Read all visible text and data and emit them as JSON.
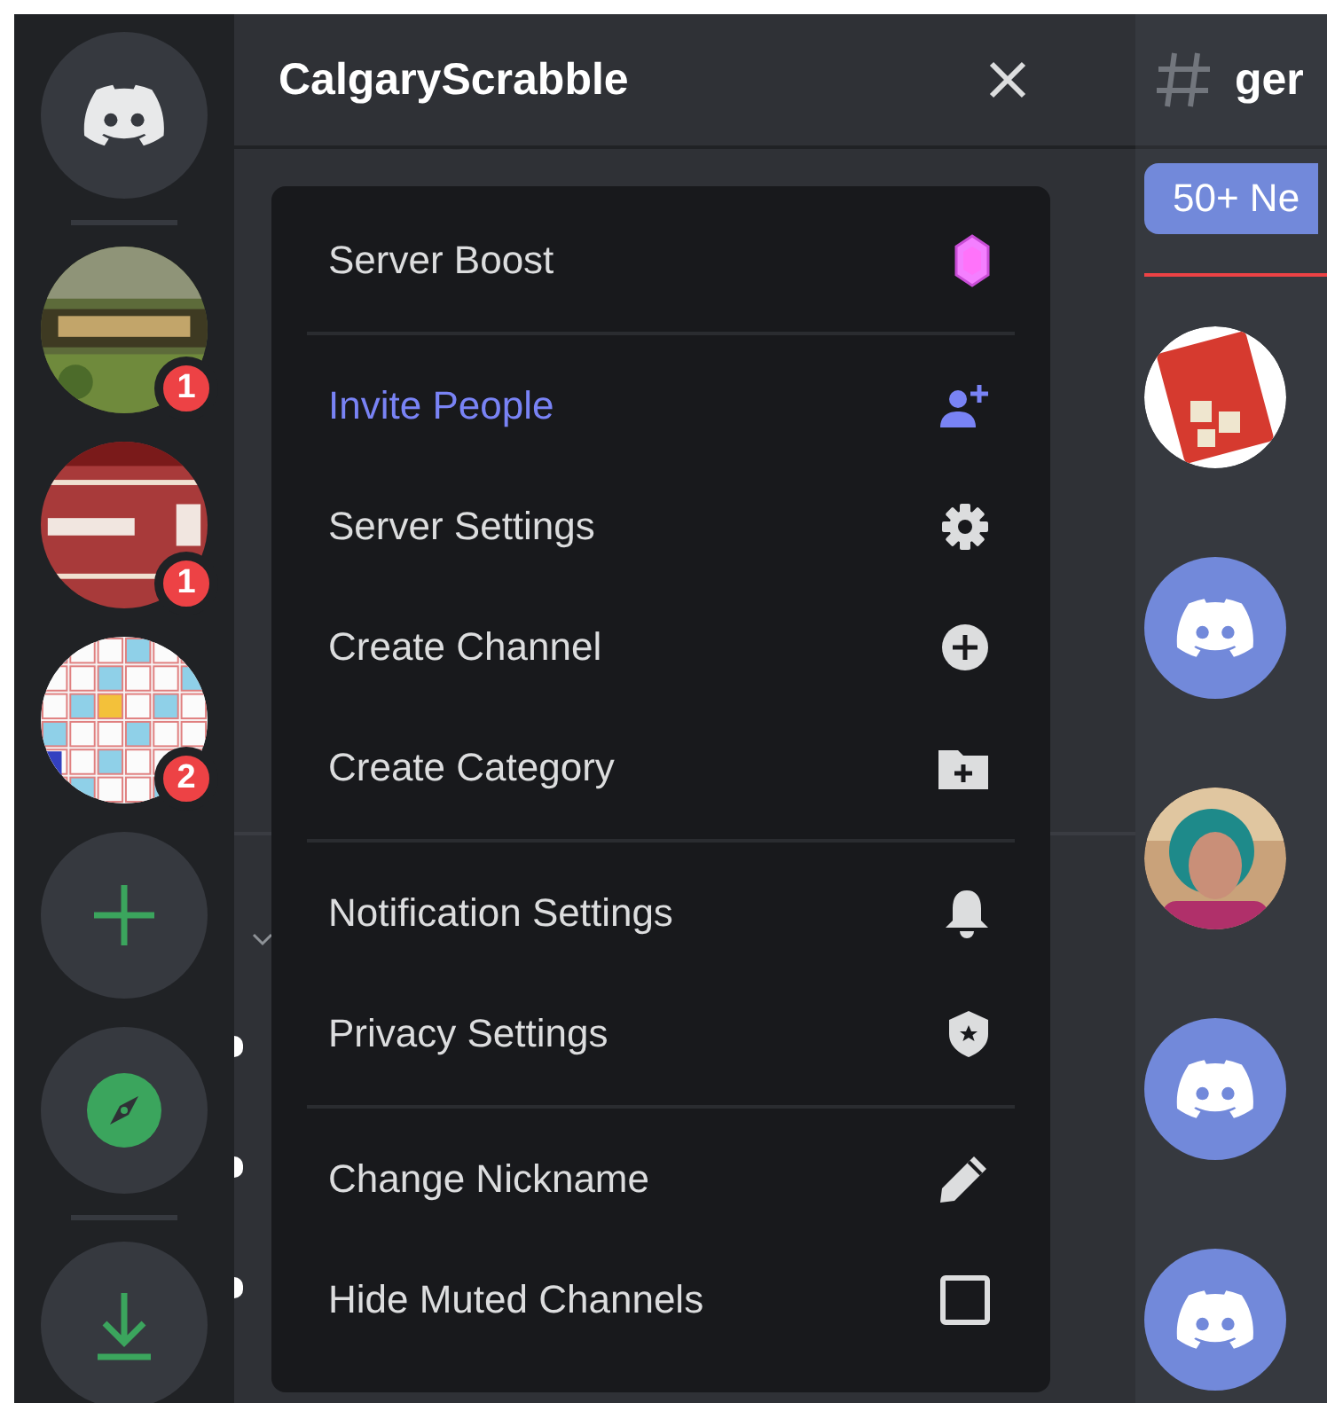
{
  "server_rail": [
    {
      "kind": "home"
    },
    {
      "kind": "server",
      "badge": "1"
    },
    {
      "kind": "server",
      "badge": "1"
    },
    {
      "kind": "server",
      "badge": "2"
    },
    {
      "kind": "add"
    },
    {
      "kind": "explore"
    },
    {
      "kind": "download"
    }
  ],
  "server_header": {
    "title": "CalgaryScrabble"
  },
  "menu": {
    "sections": [
      [
        {
          "label": "Server Boost",
          "kind": "action"
        }
      ],
      [
        {
          "label": "Invite People",
          "kind": "brand"
        },
        {
          "label": "Server Settings",
          "kind": "action"
        },
        {
          "label": "Create Channel",
          "kind": "action"
        },
        {
          "label": "Create Category",
          "kind": "action"
        }
      ],
      [
        {
          "label": "Notification Settings",
          "kind": "action"
        },
        {
          "label": "Privacy Settings",
          "kind": "action"
        }
      ],
      [
        {
          "label": "Change Nickname",
          "kind": "action"
        },
        {
          "label": "Hide Muted Channels",
          "kind": "toggle",
          "checked": false
        }
      ]
    ]
  },
  "channel": {
    "name": "ger"
  },
  "new_messages_bar": "50+ Ne",
  "messages": [
    {
      "kind": "picture"
    },
    {
      "kind": "default_avatar"
    },
    {
      "kind": "picture"
    },
    {
      "kind": "default_avatar"
    },
    {
      "kind": "default_avatar"
    }
  ]
}
